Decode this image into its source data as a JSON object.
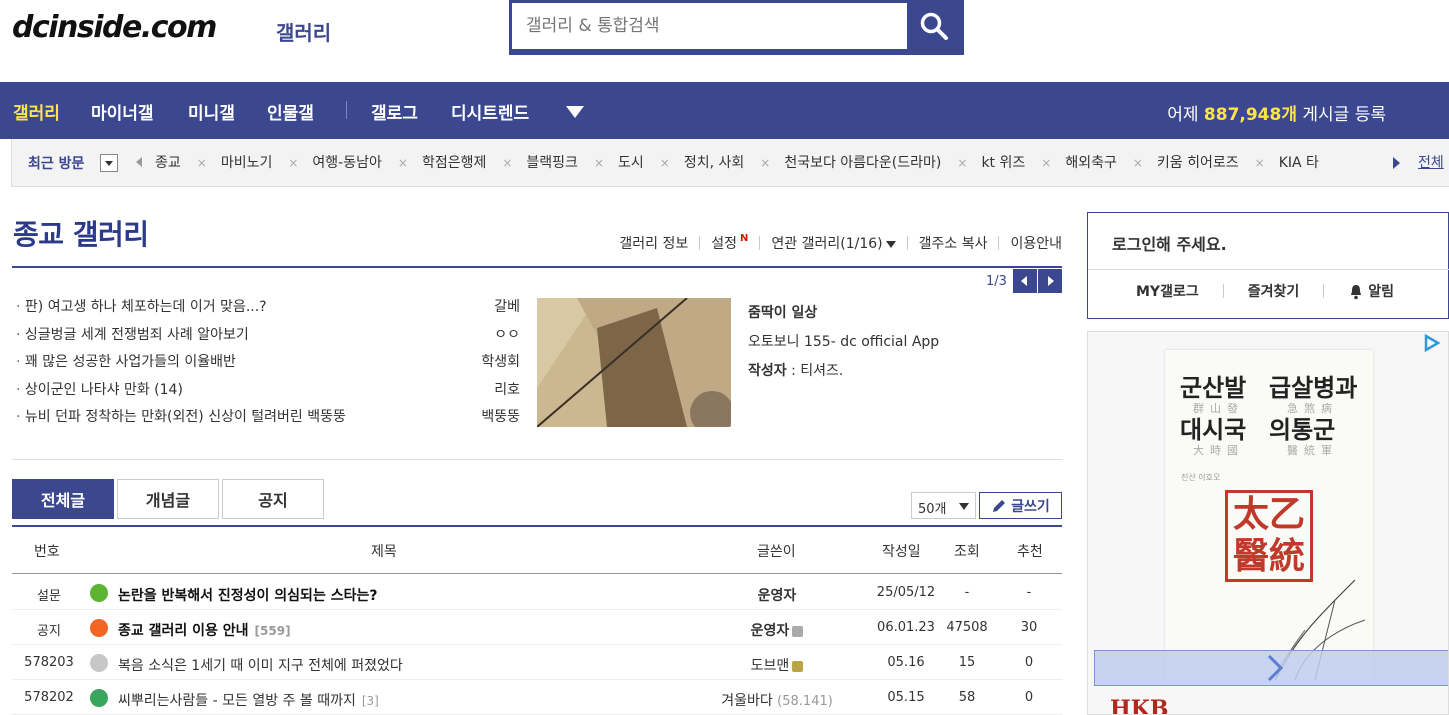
{
  "header": {
    "logo": "dcinside.com",
    "logo_sub": "갤러리",
    "search_placeholder": "갤러리 & 통합검색"
  },
  "nav": {
    "items": [
      "갤러리",
      "마이너갤",
      "미니갤",
      "인물갤",
      "갤로그",
      "디시트렌드"
    ],
    "stat_prefix": "어제",
    "stat_number": "887,948개",
    "stat_suffix": "게시글 등록"
  },
  "recent": {
    "label": "최근 방문",
    "items": [
      "종교",
      "마비노기",
      "여행-동남아",
      "학점은행제",
      "블랙핑크",
      "도시",
      "정치, 사회",
      "천국보다 아름다운(드라마)",
      "kt 위즈",
      "해외축구",
      "키움 히어로즈",
      "KIA 타"
    ],
    "all_label": "전체"
  },
  "gallery": {
    "title": "종교 갤러리",
    "menu": {
      "info": "갤러리 정보",
      "settings": "설정",
      "new_badge": "N",
      "related": "연관 갤러리(1/16)",
      "copy": "갤주소 복사",
      "guide": "이용안내"
    },
    "pager": "1/3"
  },
  "concept": {
    "rows": [
      {
        "title": "판) 여고생 하나 체포하는데 이거 맞음...?",
        "author": "갈베"
      },
      {
        "title": "싱글벙글 세계 전쟁범죄 사례 알아보기",
        "author": "ㅇㅇ"
      },
      {
        "title": "꽤 많은 성공한 사업가들의 이율배반",
        "author": "학생회"
      },
      {
        "title": "상이군인 나타샤 만화 (14)",
        "author": "리호"
      },
      {
        "title": "뉴비 던파 정착하는 만화(외전) 신상이 털려버린 백뚱뚱",
        "author": "백뚱뚱"
      }
    ],
    "info_title": "줌딱이 일상",
    "info_source": "오토보니 155- dc official App",
    "info_writer_label": "작성자",
    "info_writer": "티셔즈."
  },
  "tabs": [
    "전체글",
    "개념글",
    "공지"
  ],
  "list_controls": {
    "per_page": "50개",
    "write": "글쓰기"
  },
  "table": {
    "headers": {
      "num": "번호",
      "subject": "제목",
      "writer": "글쓴이",
      "date": "작성일",
      "views": "조회",
      "recommend": "추천"
    },
    "rows": [
      {
        "num": "설문",
        "subject": "논란을 반복해서 진정성이 의심되는 스타는?",
        "reply": "",
        "writer": "운영자",
        "ip": "",
        "date": "25/05/12",
        "views": "-",
        "rec": "-",
        "icon": "poll-icon",
        "color": "#5cb531"
      },
      {
        "num": "공지",
        "subject": "종교 갤러리 이용 안내",
        "reply": "[559]",
        "writer": "운영자",
        "ip": "",
        "date": "06.01.23",
        "views": "47508",
        "rec": "30",
        "icon": "notice-icon",
        "color": "#f26522"
      },
      {
        "num": "578203",
        "subject": "복음 소식은 1세기 때 이미 지구 전체에 퍼졌었다",
        "reply": "",
        "writer": "도브맨",
        "ip": "",
        "date": "05.16",
        "views": "15",
        "rec": "0",
        "icon": "text-post-icon",
        "color": "#c7c7c7"
      },
      {
        "num": "578202",
        "subject": "씨뿌리는사람들 - 모든 열방 주 볼 때까지",
        "reply": "[3]",
        "writer": "겨울바다",
        "ip": "(58.141)",
        "date": "05.15",
        "views": "58",
        "rec": "0",
        "icon": "image-post-icon",
        "color": "#3aa55c"
      }
    ]
  },
  "sidebar": {
    "login_title": "로그인해 주세요.",
    "links": [
      "MY갤로그",
      "즐겨찾기",
      "알림"
    ],
    "ad": {
      "line1a": "군산발",
      "line1b": "급살병과",
      "line1a_hanja": "群山發",
      "line1b_hanja": "急煞病",
      "line2a": "대시국",
      "line2b": "의통군",
      "line2a_hanja": "大時國",
      "line2b_hanja": "醫統軍",
      "seal": "太乙醫統",
      "author": "진산 이호오",
      "brand": "HKB"
    }
  },
  "colors": {
    "brand": "#3b4890",
    "accent": "#ffe34a"
  }
}
